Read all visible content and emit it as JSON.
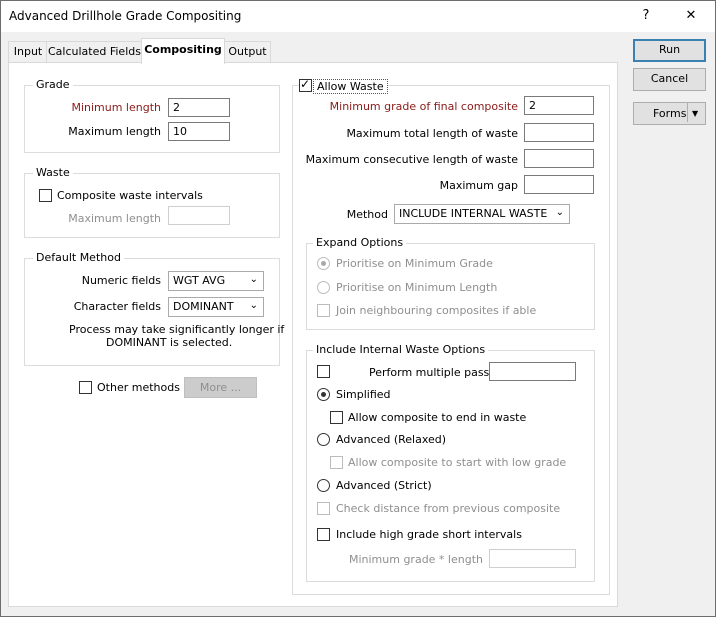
{
  "window": {
    "title": "Advanced Drillhole Grade Compositing",
    "help_glyph": "?",
    "close_glyph": "✕"
  },
  "tabs": [
    {
      "label": "Input"
    },
    {
      "label": "Calculated Fields"
    },
    {
      "label": "Compositing",
      "active": true
    },
    {
      "label": "Output"
    }
  ],
  "buttons": {
    "run": "Run",
    "cancel": "Cancel",
    "forms": "Forms",
    "forms_arrow": "▼"
  },
  "grade": {
    "title": "Grade",
    "min_length_label": "Minimum length",
    "min_length_value": "2",
    "max_length_label": "Maximum length",
    "max_length_value": "10"
  },
  "waste": {
    "title": "Waste",
    "composite_label": "Composite waste intervals",
    "composite_checked": false,
    "max_length_label": "Maximum length",
    "max_length_value": ""
  },
  "default_method": {
    "title": "Default Method",
    "numeric_label": "Numeric fields",
    "numeric_value": "WGT AVG",
    "character_label": "Character fields",
    "character_value": "DOMINANT",
    "note_line1": "Process may take significantly longer if",
    "note_line2": "DOMINANT is selected."
  },
  "other": {
    "label": "Other methods",
    "checked": false,
    "more_label": "More ..."
  },
  "allow_waste": {
    "label": "Allow Waste",
    "checked": true,
    "min_grade_label": "Minimum grade of final composite",
    "min_grade_value": "2",
    "max_total_label": "Maximum total length of waste",
    "max_total_value": "",
    "max_consec_label": "Maximum consecutive length of waste",
    "max_consec_value": "",
    "max_gap_label": "Maximum gap",
    "max_gap_value": "",
    "method_label": "Method",
    "method_value": "INCLUDE INTERNAL WASTE"
  },
  "expand": {
    "title": "Expand Options",
    "prioritise_grade": "Prioritise on Minimum Grade",
    "prioritise_length": "Prioritise on Minimum Length",
    "join": "Join neighbouring composites if able"
  },
  "internal": {
    "title": "Include Internal Waste Options",
    "multiple_passes": "Perform multiple passes",
    "multiple_passes_value": "",
    "simplified": "Simplified",
    "end_in_waste": "Allow composite to end in waste",
    "relaxed": "Advanced (Relaxed)",
    "start_low": "Allow composite to start with low grade",
    "strict": "Advanced (Strict)",
    "check_distance": "Check distance from previous composite",
    "high_grade": "Include high grade short intervals",
    "min_grade_length": "Minimum grade * length",
    "min_grade_length_value": ""
  },
  "colors": {
    "accent": "#3c7fb1",
    "required_label": "#8b1a1a"
  }
}
